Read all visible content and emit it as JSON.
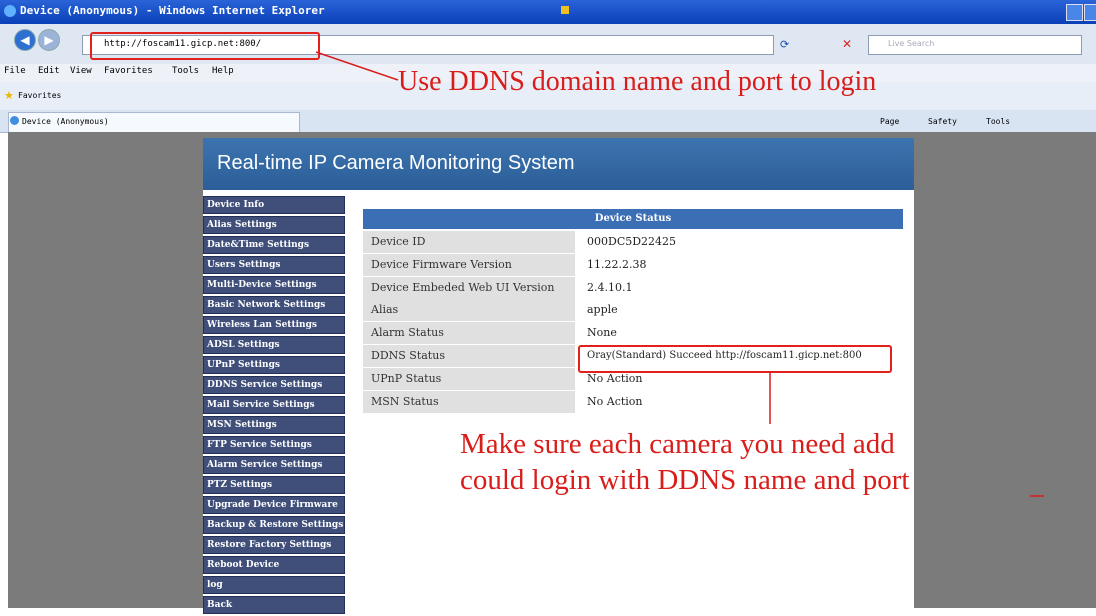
{
  "window": {
    "title": "Device (Anonymous) - Windows Internet Explorer"
  },
  "browser": {
    "address": "http://foscam11.gicp.net:800/",
    "search_placeholder": "Live Search",
    "menu": [
      "File",
      "Edit",
      "View",
      "Favorites",
      "Tools",
      "Help"
    ],
    "favorites_label": "Favorites",
    "tab_label": "Device (Anonymous)",
    "command_bar": [
      "Page",
      "Safety",
      "Tools"
    ]
  },
  "page": {
    "title": "Real-time IP Camera Monitoring System",
    "sidebar": [
      "Device Info",
      "Alias Settings",
      "Date&Time Settings",
      "Users Settings",
      "Multi-Device Settings",
      "Basic Network Settings",
      "Wireless Lan Settings",
      "ADSL Settings",
      "UPnP Settings",
      "DDNS Service Settings",
      "Mail Service Settings",
      "MSN Settings",
      "FTP Service Settings",
      "Alarm Service Settings",
      "PTZ Settings",
      "Upgrade Device Firmware",
      "Backup & Restore Settings",
      "Restore Factory Settings",
      "Reboot Device",
      "log",
      "Back"
    ],
    "status": {
      "header": "Device Status",
      "rows": [
        {
          "key": "Device ID",
          "value": "000DC5D22425"
        },
        {
          "key": "Device Firmware Version",
          "value": "11.22.2.38"
        },
        {
          "key": "Device Embeded Web UI Version",
          "value": "2.4.10.1"
        },
        {
          "key": "Alias",
          "value": "apple"
        },
        {
          "key": "Alarm Status",
          "value": "None"
        },
        {
          "key": "DDNS Status",
          "value": "Oray(Standard) Succeed  http://foscam11.gicp.net:800"
        },
        {
          "key": "UPnP Status",
          "value": "No Action"
        },
        {
          "key": "MSN Status",
          "value": "No Action"
        }
      ]
    }
  },
  "annotations": {
    "top": "Use DDNS domain name and port to login",
    "bottom": "Make sure each camera you need add could login with DDNS name and port"
  },
  "colors": {
    "annotation_red": "#d91d1a",
    "header_blue": "#3c74b0",
    "sidebar_navy": "#3f4f7a",
    "background_gray": "#7b7b7b"
  }
}
